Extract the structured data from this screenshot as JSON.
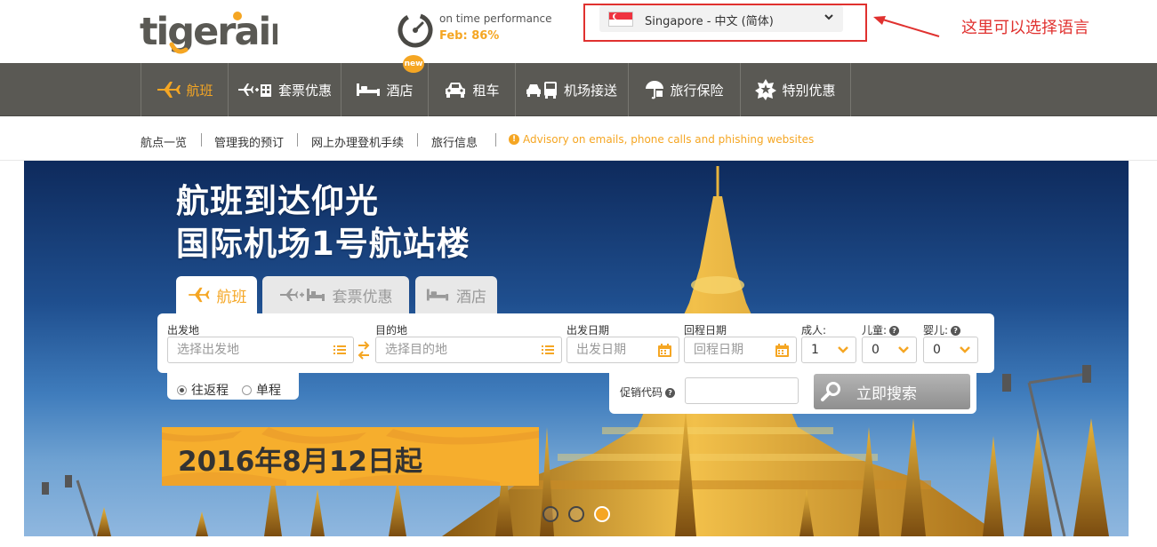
{
  "brand": {
    "logo_text": "tigerair",
    "accent": "#f5a623",
    "nav_bg": "#5a5954"
  },
  "on_time": {
    "label": "on time performance",
    "value": "Feb: 86%"
  },
  "language": {
    "selected": "Singapore - 中文 (简体)"
  },
  "annotation": {
    "text": "这里可以选择语言",
    "color": "#e0312f"
  },
  "nav": {
    "items": [
      {
        "label": "航班",
        "icon": "plane-icon"
      },
      {
        "label": "套票优惠",
        "icon": "plane-hotel-icon"
      },
      {
        "label": "酒店",
        "icon": "bed-icon"
      },
      {
        "label": "租车",
        "icon": "car-icon"
      },
      {
        "label": "机场接送",
        "icon": "car-bus-icon"
      },
      {
        "label": "旅行保险",
        "icon": "umbrella-icon"
      },
      {
        "label": "特别优惠",
        "icon": "star-badge-icon"
      }
    ],
    "badge": "new"
  },
  "subnav": {
    "items": [
      "航点一览",
      "管理我的预订",
      "网上办理登机手续",
      "旅行信息"
    ],
    "advisory": "Advisory on emails, phone calls and phishing websites"
  },
  "hero": {
    "title_line1": "航班到达仰光",
    "title_line2": "国际机场1号航站楼",
    "banner": "2016年8月12日起"
  },
  "booking": {
    "tabs": [
      "航班",
      "套票优惠",
      "酒店"
    ],
    "from_label": "出发地",
    "from_placeholder": "选择出发地",
    "to_label": "目的地",
    "to_placeholder": "选择目的地",
    "depart_label": "出发日期",
    "depart_placeholder": "出发日期",
    "return_label": "回程日期",
    "return_placeholder": "回程日期",
    "adults_label": "成人:",
    "adults_value": "1",
    "children_label": "儿童:",
    "children_value": "0",
    "infants_label": "婴儿:",
    "infants_value": "0",
    "trip_return": "往返程",
    "trip_oneway": "单程",
    "promo_label": "促销代码",
    "search_label": "立即搜索"
  }
}
